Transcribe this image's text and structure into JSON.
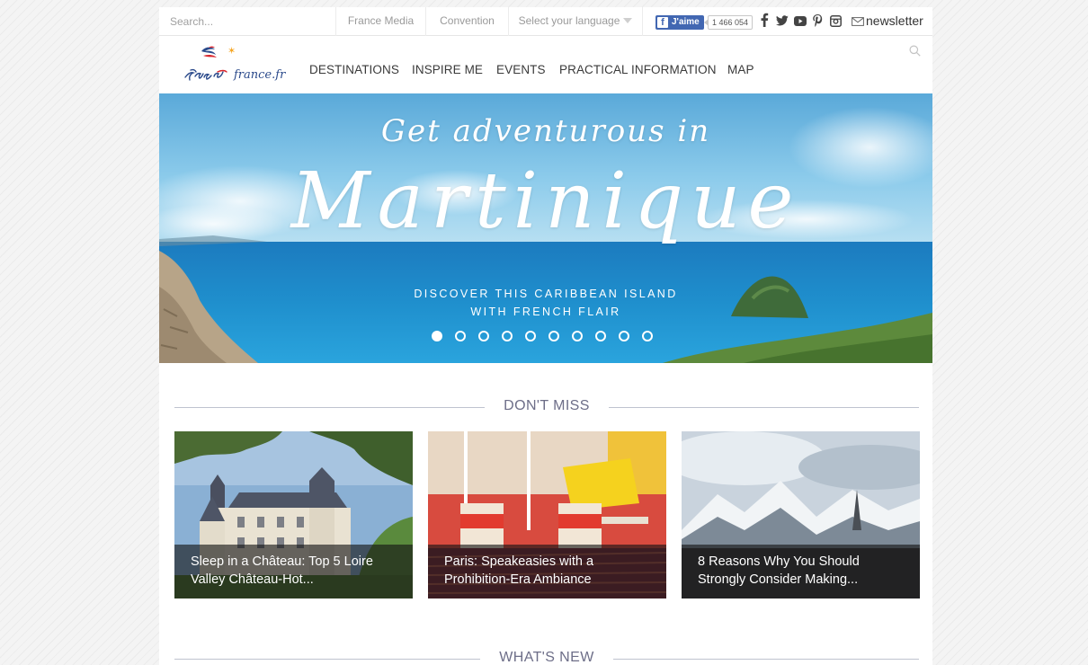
{
  "topbar": {
    "search_placeholder": "Search...",
    "links": [
      "France Media",
      "Convention"
    ],
    "language_select": "Select your language",
    "fb_like_label": "J'aime",
    "fb_like_count": "1 466 054",
    "social_icons": [
      "facebook-icon",
      "twitter-icon",
      "youtube-icon",
      "pinterest-icon",
      "instagram-icon"
    ],
    "newsletter_label": "newsletter"
  },
  "navbar": {
    "logo_text": "france.fr",
    "items": [
      "DESTINATIONS",
      "INSPIRE ME",
      "EVENTS",
      "PRACTICAL INFORMATION",
      "MAP"
    ]
  },
  "hero": {
    "tagline": "Get adventurous in",
    "title": "Martinique",
    "subtitle_line1": "DISCOVER THIS CARIBBEAN ISLAND",
    "subtitle_line2": "WITH FRENCH FLAIR",
    "slide_count": 10,
    "active_slide": 1
  },
  "sections": {
    "dont_miss": "DON'T MISS",
    "whats_new": "WHAT'S NEW"
  },
  "cards": [
    {
      "caption_line1": "Sleep in a Château: Top 5 Loire",
      "caption_line2": "Valley Château-Hot..."
    },
    {
      "caption_line1": "Paris: Speakeasies with a",
      "caption_line2": "Prohibition-Era Ambiance"
    },
    {
      "caption_line1": "8 Reasons Why You Should",
      "caption_line2": "Strongly Consider Making..."
    }
  ],
  "colors": {
    "brand_blue": "#2b4a8b",
    "facebook_blue": "#4267b2",
    "section_heading": "#6d6e88",
    "hero_sea": "#1f8fcd"
  }
}
